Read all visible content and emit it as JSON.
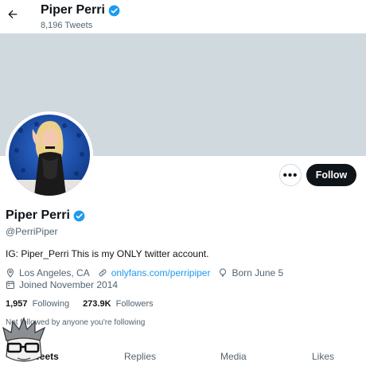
{
  "header": {
    "title": "Piper Perri",
    "tweet_count": "8,196 Tweets"
  },
  "profile": {
    "display_name": "Piper Perri",
    "handle": "@PerriPiper",
    "bio": "IG: Piper_Perri This is my ONLY twitter account.",
    "location": "Los Angeles, CA",
    "website": "onlyfans.com/perripiper",
    "birthday": "Born June 5",
    "joined": "Joined November 2014",
    "following_count": "1,957",
    "following_label": "Following",
    "followers_count": "273.9K",
    "followers_label": "Followers",
    "not_followed": "Not followed by anyone you're following"
  },
  "actions": {
    "more_label": "•••",
    "follow_label": "Follow"
  },
  "tabs": [
    {
      "label": "Tweets"
    },
    {
      "label": "Replies"
    },
    {
      "label": "Media"
    },
    {
      "label": "Likes"
    }
  ],
  "icons": {
    "back": "arrow-left-icon",
    "verified": "verified-badge-icon",
    "location": "location-pin-icon",
    "link": "link-icon",
    "birthday": "balloon-icon",
    "joined": "calendar-icon"
  },
  "colors": {
    "accent": "#1d9bf0",
    "banner": "#cfd9de",
    "follow_button": "#0f1419",
    "secondary_text": "#536471"
  }
}
